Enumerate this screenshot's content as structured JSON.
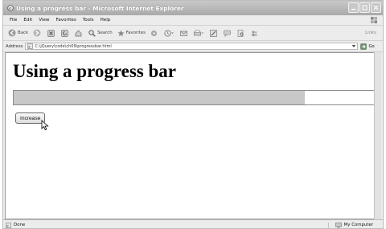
{
  "window": {
    "title": "Using a progress bar - Microsoft Internet Explorer"
  },
  "menubar": {
    "items": [
      "File",
      "Edit",
      "View",
      "Favorites",
      "Tools",
      "Help"
    ]
  },
  "toolbar": {
    "back_label": "Back",
    "search_label": "Search",
    "favorites_label": "Favorites",
    "links_label": "Links"
  },
  "addressbar": {
    "label": "Address",
    "url": "C:\\jQuery\\code\\ch09\\progressbar.html",
    "go_label": "Go"
  },
  "page": {
    "heading": "Using a progress bar",
    "progress_fraction": 0.8,
    "increase_label": "Increase"
  },
  "statusbar": {
    "status_text": "Done",
    "zone_text": "My Computer"
  },
  "colors": {
    "progress_fill": "#c8c8c8",
    "titlebar": "#a9a9a9"
  }
}
